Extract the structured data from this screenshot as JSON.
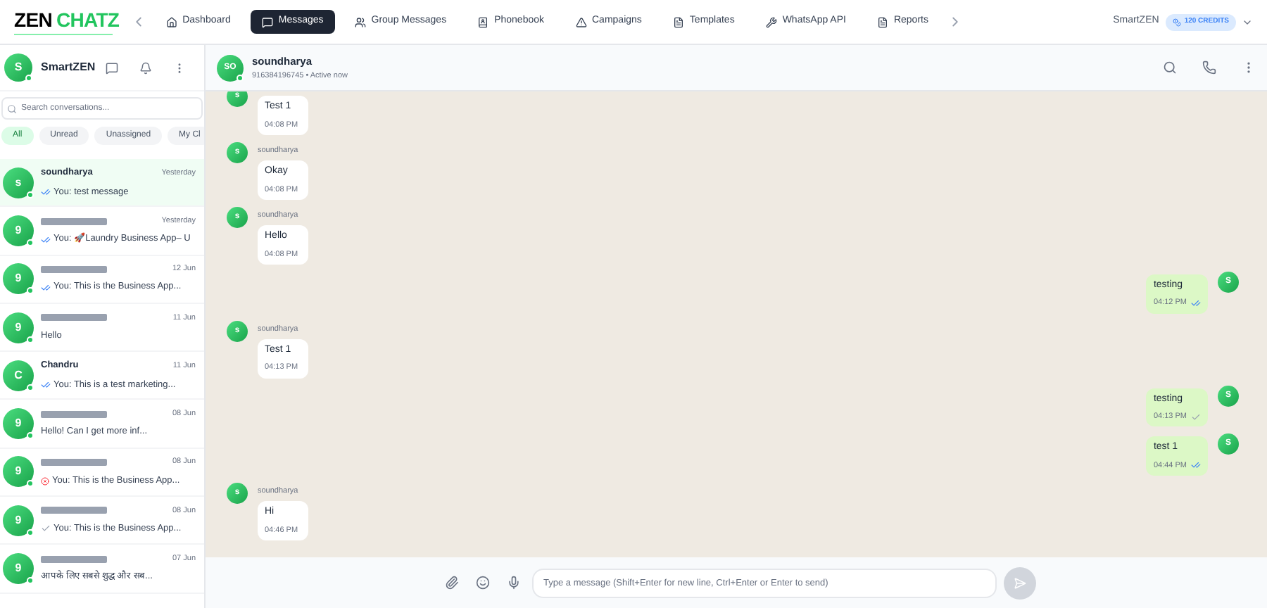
{
  "logo": {
    "part_1": "ZEN",
    "part_2": "CHATZ"
  },
  "nav": [
    {
      "label": "Dashboard",
      "selected": false
    },
    {
      "label": "Messages",
      "selected": true
    },
    {
      "label": "Group Messages",
      "selected": false
    },
    {
      "label": "Phonebook",
      "selected": false
    },
    {
      "label": "Campaigns",
      "selected": false
    },
    {
      "label": "Templates",
      "selected": false
    },
    {
      "label": "WhatsApp API",
      "selected": false
    },
    {
      "label": "Reports",
      "selected": false
    }
  ],
  "account": {
    "name": "SmartZEN",
    "credits": "120 CREDITS"
  },
  "sidebar": {
    "avatar": "S",
    "name": "SmartZEN",
    "online": true,
    "search": {
      "placeholder": "Search conversations..."
    },
    "filters": [
      {
        "label": "All",
        "selected": true
      },
      {
        "label": "Unread",
        "selected": false
      },
      {
        "label": "Unassigned",
        "selected": false
      },
      {
        "label": "My Cl",
        "selected": false
      }
    ],
    "conversations": [
      {
        "avatar": "s",
        "name": "soundharya",
        "redacted": false,
        "time": "Yesterday",
        "kind": "read",
        "preview": "You: test message",
        "selected": true
      },
      {
        "avatar": "9",
        "redacted": true,
        "time": "Yesterday",
        "kind": "read",
        "preview": "You: 🚀Laundry Business App– U",
        "selected": false
      },
      {
        "avatar": "9",
        "redacted": true,
        "time": "12 Jun",
        "kind": "read",
        "preview": "You: This is the Business App...",
        "selected": false
      },
      {
        "avatar": "9",
        "redacted": true,
        "time": "11 Jun",
        "kind": "plain",
        "preview": "Hello",
        "selected": false
      },
      {
        "avatar": "C",
        "name": "Chandru",
        "redacted": false,
        "time": "11 Jun",
        "kind": "read",
        "preview": "You: This is a test marketing...",
        "selected": false
      },
      {
        "avatar": "9",
        "redacted": true,
        "time": "08 Jun",
        "kind": "plain",
        "preview": "Hello! Can I get more inf...",
        "selected": false
      },
      {
        "avatar": "9",
        "redacted": true,
        "time": "08 Jun",
        "kind": "failed",
        "preview": "You: This is the Business App...",
        "selected": false
      },
      {
        "avatar": "9",
        "redacted": true,
        "time": "08 Jun",
        "kind": "sent",
        "preview": "You: This is the Business App...",
        "selected": false
      },
      {
        "avatar": "9",
        "redacted": true,
        "time": "07 Jun",
        "kind": "plain",
        "preview": "आपके लिए सबसे शुद्ध और सब...",
        "selected": false
      }
    ]
  },
  "chat": {
    "avatar": "SO",
    "name": "soundharya",
    "subtitle": "916384196745 • Active now",
    "online": true,
    "messages": [
      {
        "kind": "incoming",
        "avatar": "s",
        "text": "Test 1",
        "time": "04:08 PM"
      },
      {
        "kind": "incoming",
        "avatar": "s",
        "sender": "soundharya",
        "text": "Okay",
        "time": "04:08 PM"
      },
      {
        "kind": "incoming",
        "avatar": "s",
        "sender": "soundharya",
        "text": "Hello",
        "time": "04:08 PM"
      },
      {
        "kind": "outgoing",
        "avatar": "S",
        "text": "testing",
        "time": "04:12 PM",
        "read": true
      },
      {
        "kind": "incoming",
        "avatar": "s",
        "sender": "soundharya",
        "text": "Test 1",
        "time": "04:13 PM"
      },
      {
        "kind": "outgoing",
        "avatar": "S",
        "text": "testing",
        "time": "04:13 PM",
        "read": false
      },
      {
        "kind": "outgoing",
        "avatar": "S",
        "text": "test 1",
        "time": "04:44 PM",
        "read": true
      },
      {
        "kind": "incoming",
        "avatar": "s",
        "sender": "soundharya",
        "text": "Hi",
        "time": "04:46 PM"
      }
    ],
    "composer": {
      "placeholder": "Type a message (Shift+Enter for new line, Ctrl+Enter or Enter to send)"
    }
  }
}
